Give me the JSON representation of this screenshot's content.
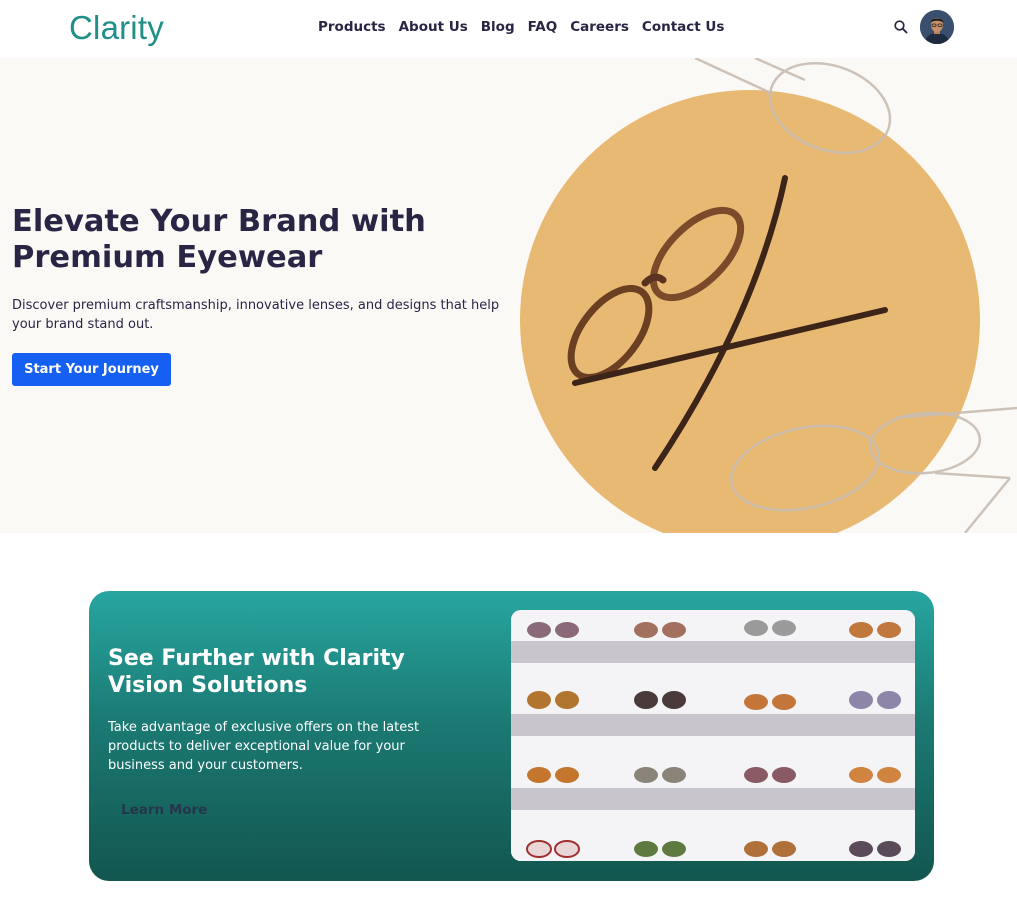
{
  "header": {
    "logo": "Clarity",
    "nav": [
      "Products",
      "About Us",
      "Blog",
      "FAQ",
      "Careers",
      "Contact Us"
    ],
    "icons": {
      "search": "search-icon",
      "avatar": "user-avatar"
    }
  },
  "hero": {
    "title": "Elevate Your Brand with Premium Eyewear",
    "subtitle": "Discover premium craftsmanship, innovative lenses, and designs that help your brand stand out.",
    "cta": "Start Your Journey"
  },
  "promo": {
    "title": "See Further with Clarity Vision Solutions",
    "text": "Take advantage of exclusive offers on the latest products to deliver exceptional value for your business and your customers.",
    "link": "Learn More"
  },
  "colors": {
    "brand": "#1f8f87",
    "primary_button": "#1560f2",
    "text_dark": "#2b2545",
    "hero_circle": "#e8b973",
    "promo_gradient_top": "#27a6a0",
    "promo_gradient_bottom": "#12564f"
  }
}
